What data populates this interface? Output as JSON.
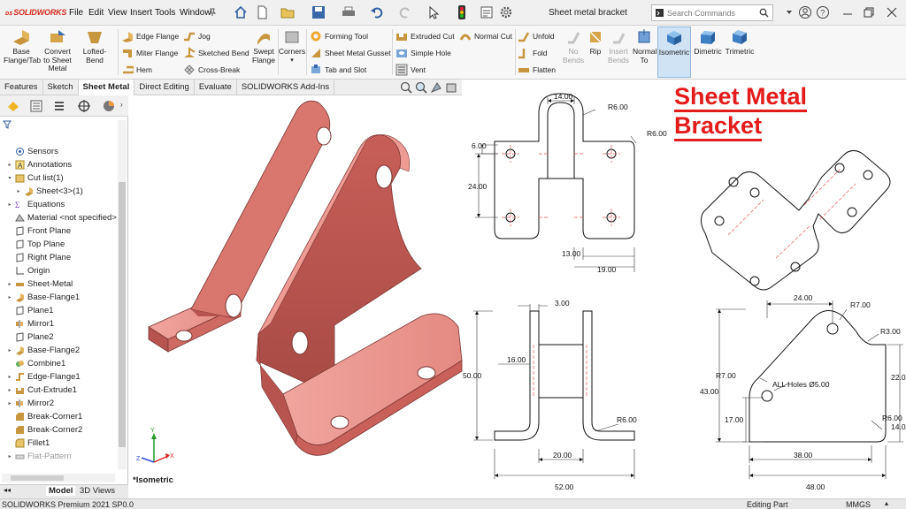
{
  "app": {
    "logo_text": "SOLIDWORKS",
    "menu": [
      "File",
      "Edit",
      "View",
      "Insert",
      "Tools",
      "Window"
    ],
    "document_title": "Sheet metal bracket",
    "search_placeholder": "Search Commands"
  },
  "ribbon": {
    "buttons": {
      "base_flange": "Base Flange/Tab",
      "convert": "Convert to Sheet Metal",
      "lofted_bend": "Lofted-Bend",
      "edge_flange": "Edge Flange",
      "miter_flange": "Miter Flange",
      "hem": "Hem",
      "jog": "Jog",
      "sketched_bend": "Sketched Bend",
      "cross_break": "Cross-Break",
      "swept_flange": "Swept Flange",
      "corners": "Corners",
      "forming_tool": "Forming Tool",
      "sm_gusset": "Sheet Metal Gusset",
      "tab_slot": "Tab and Slot",
      "extruded_cut": "Extruded Cut",
      "simple_hole": "Simple Hole",
      "vent": "Vent",
      "normal_cut": "Normal Cut",
      "unfold": "Unfold",
      "fold": "Fold",
      "flatten": "Flatten",
      "no_bends": "No Bends",
      "rip": "Rip",
      "insert_bends": "Insert Bends",
      "normal_to": "Normal To",
      "isometric": "Isometric",
      "dimetric": "Dimetric",
      "trimetric": "Trimetric"
    }
  },
  "tabs": [
    "Features",
    "Sketch",
    "Sheet Metal",
    "Direct Editing",
    "Evaluate",
    "SOLIDWORKS Add-Ins"
  ],
  "active_tab": "Sheet Metal",
  "tree": [
    {
      "label": "Sensors",
      "icon": "sensor-icon",
      "arrow": false
    },
    {
      "label": "Annotations",
      "icon": "annotation-icon",
      "arrow": true
    },
    {
      "label": "Cut list(1)",
      "icon": "cutlist-icon",
      "arrow": true,
      "open": true
    },
    {
      "label": "Sheet<3>(1)",
      "icon": "sheet-icon",
      "arrow": true,
      "indent": 1
    },
    {
      "label": "Equations",
      "icon": "equation-icon",
      "arrow": true
    },
    {
      "label": "Material <not specified>",
      "icon": "material-icon",
      "arrow": false
    },
    {
      "label": "Front Plane",
      "icon": "plane-icon",
      "arrow": false
    },
    {
      "label": "Top Plane",
      "icon": "plane-icon",
      "arrow": false
    },
    {
      "label": "Right Plane",
      "icon": "plane-icon",
      "arrow": false
    },
    {
      "label": "Origin",
      "icon": "origin-icon",
      "arrow": false
    },
    {
      "label": "Sheet-Metal",
      "icon": "sheetmetal-icon",
      "arrow": true
    },
    {
      "label": "Base-Flange1",
      "icon": "flange-icon",
      "arrow": true
    },
    {
      "label": "Plane1",
      "icon": "plane-icon",
      "arrow": false
    },
    {
      "label": "Mirror1",
      "icon": "mirror-icon",
      "arrow": false
    },
    {
      "label": "Plane2",
      "icon": "plane-icon",
      "arrow": false
    },
    {
      "label": "Base-Flange2",
      "icon": "flange-icon",
      "arrow": true
    },
    {
      "label": "Combine1",
      "icon": "combine-icon",
      "arrow": false
    },
    {
      "label": "Edge-Flange1",
      "icon": "edgeflange-icon",
      "arrow": true
    },
    {
      "label": "Cut-Extrude1",
      "icon": "cut-icon",
      "arrow": true
    },
    {
      "label": "Mirror2",
      "icon": "mirror-icon",
      "arrow": true
    },
    {
      "label": "Break-Corner1",
      "icon": "corner-icon",
      "arrow": false
    },
    {
      "label": "Break-Corner2",
      "icon": "corner-icon",
      "arrow": false
    },
    {
      "label": "Fillet1",
      "icon": "fillet-icon",
      "arrow": false
    },
    {
      "label": "Flat-Pattern",
      "icon": "flatpattern-icon",
      "arrow": true,
      "dim": true
    }
  ],
  "bottom_tabs": [
    "Model",
    "3D Views"
  ],
  "viewport": {
    "view_label": "*Isometric"
  },
  "status": {
    "left": "SOLIDWORKS Premium 2021 SP0.0",
    "mode": "Editing Part",
    "units": "MMGS"
  },
  "headline": {
    "line1": "Sheet Metal",
    "line2": "Bracket"
  },
  "drawing": {
    "top_view": {
      "d14": "14.00",
      "r6a": "R6.00",
      "r6b": "R6.00",
      "d6": "6.00",
      "d24": "24.00",
      "d13": "13.00",
      "d19": "19.00"
    },
    "front_view": {
      "d3": "3.00",
      "d16": "16.00",
      "d50": "50.00",
      "r6": "R6.00",
      "d20": "20.00",
      "d52": "52.00"
    },
    "side_view": {
      "d24": "24.00",
      "r7a": "R7.00",
      "r3": "R3.00",
      "r7b": "R7.00",
      "holes": "ALL Holes Ø5.00",
      "d43": "43.00",
      "d17": "17.00",
      "d22": "22.0",
      "r6": "R6.00",
      "d14": "14.0",
      "d38": "38.00",
      "d48": "48.00"
    }
  },
  "colors": {
    "part": "#e07a72",
    "part_dark": "#b6514c",
    "part_light": "#f2a9a2",
    "accent": "#e31b1b"
  }
}
